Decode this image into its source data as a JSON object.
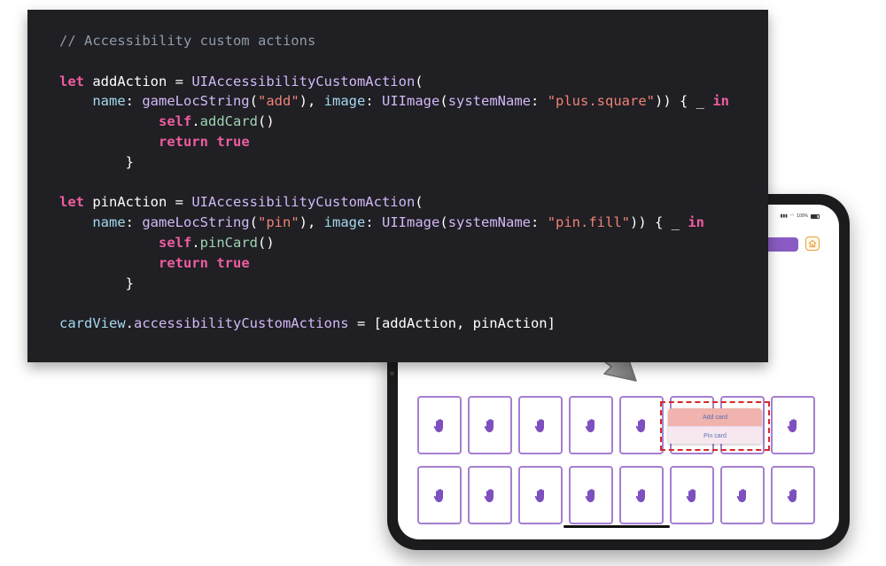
{
  "code": {
    "lines": [
      [
        {
          "t": "// Accessibility custom actions",
          "c": "comment"
        }
      ],
      [],
      [
        {
          "t": "let",
          "c": "kw"
        },
        {
          "t": " addAction = ",
          "c": "plain"
        },
        {
          "t": "UIAccessibilityCustomAction",
          "c": "type"
        },
        {
          "t": "(",
          "c": "plain"
        }
      ],
      [
        {
          "t": "    ",
          "c": "plain"
        },
        {
          "t": "name",
          "c": "arg"
        },
        {
          "t": ": ",
          "c": "plain"
        },
        {
          "t": "gameLocString",
          "c": "type"
        },
        {
          "t": "(",
          "c": "plain"
        },
        {
          "t": "\"add\"",
          "c": "str"
        },
        {
          "t": "), ",
          "c": "plain"
        },
        {
          "t": "image",
          "c": "arg"
        },
        {
          "t": ": ",
          "c": "plain"
        },
        {
          "t": "UIImage",
          "c": "type"
        },
        {
          "t": "(",
          "c": "plain"
        },
        {
          "t": "systemName",
          "c": "type"
        },
        {
          "t": ": ",
          "c": "plain"
        },
        {
          "t": "\"plus.square\"",
          "c": "str"
        },
        {
          "t": ")) { _ ",
          "c": "plain"
        },
        {
          "t": "in",
          "c": "kw"
        }
      ],
      [
        {
          "t": "            ",
          "c": "plain"
        },
        {
          "t": "self",
          "c": "kw"
        },
        {
          "t": ".",
          "c": "plain"
        },
        {
          "t": "addCard",
          "c": "call"
        },
        {
          "t": "()",
          "c": "plain"
        }
      ],
      [
        {
          "t": "            ",
          "c": "plain"
        },
        {
          "t": "return",
          "c": "kw"
        },
        {
          "t": " ",
          "c": "plain"
        },
        {
          "t": "true",
          "c": "kw"
        }
      ],
      [
        {
          "t": "        }",
          "c": "plain"
        }
      ],
      [],
      [
        {
          "t": "let",
          "c": "kw"
        },
        {
          "t": " pinAction = ",
          "c": "plain"
        },
        {
          "t": "UIAccessibilityCustomAction",
          "c": "type"
        },
        {
          "t": "(",
          "c": "plain"
        }
      ],
      [
        {
          "t": "    ",
          "c": "plain"
        },
        {
          "t": "name",
          "c": "arg"
        },
        {
          "t": ": ",
          "c": "plain"
        },
        {
          "t": "gameLocString",
          "c": "type"
        },
        {
          "t": "(",
          "c": "plain"
        },
        {
          "t": "\"pin\"",
          "c": "str"
        },
        {
          "t": "), ",
          "c": "plain"
        },
        {
          "t": "image",
          "c": "arg"
        },
        {
          "t": ": ",
          "c": "plain"
        },
        {
          "t": "UIImage",
          "c": "type"
        },
        {
          "t": "(",
          "c": "plain"
        },
        {
          "t": "systemName",
          "c": "type"
        },
        {
          "t": ": ",
          "c": "plain"
        },
        {
          "t": "\"pin.fill\"",
          "c": "str"
        },
        {
          "t": ")) { _ ",
          "c": "plain"
        },
        {
          "t": "in",
          "c": "kw"
        }
      ],
      [
        {
          "t": "            ",
          "c": "plain"
        },
        {
          "t": "self",
          "c": "kw"
        },
        {
          "t": ".",
          "c": "plain"
        },
        {
          "t": "pinCard",
          "c": "call"
        },
        {
          "t": "()",
          "c": "plain"
        }
      ],
      [
        {
          "t": "            ",
          "c": "plain"
        },
        {
          "t": "return",
          "c": "kw"
        },
        {
          "t": " ",
          "c": "plain"
        },
        {
          "t": "true",
          "c": "kw"
        }
      ],
      [
        {
          "t": "        }",
          "c": "plain"
        }
      ],
      [],
      [
        {
          "t": "cardView",
          "c": "arg"
        },
        {
          "t": ".",
          "c": "plain"
        },
        {
          "t": "accessibilityCustomActions",
          "c": "type"
        },
        {
          "t": " = [addAction, pinAction]",
          "c": "plain"
        }
      ]
    ]
  },
  "ipad": {
    "status_battery": "100%",
    "home_icon": "house-icon",
    "card_icon": "hand-raised-icon",
    "card_count": 16,
    "action_menu": {
      "items": [
        "Add card",
        "Pin card"
      ]
    }
  },
  "colors": {
    "code_background": "#1f1f24",
    "card_border": "#a57fd1",
    "card_icon": "#7d4fbf",
    "accent_purple": "#8a5cc3",
    "home_orange": "#e6a23c",
    "highlight_dashed": "#d62828"
  }
}
